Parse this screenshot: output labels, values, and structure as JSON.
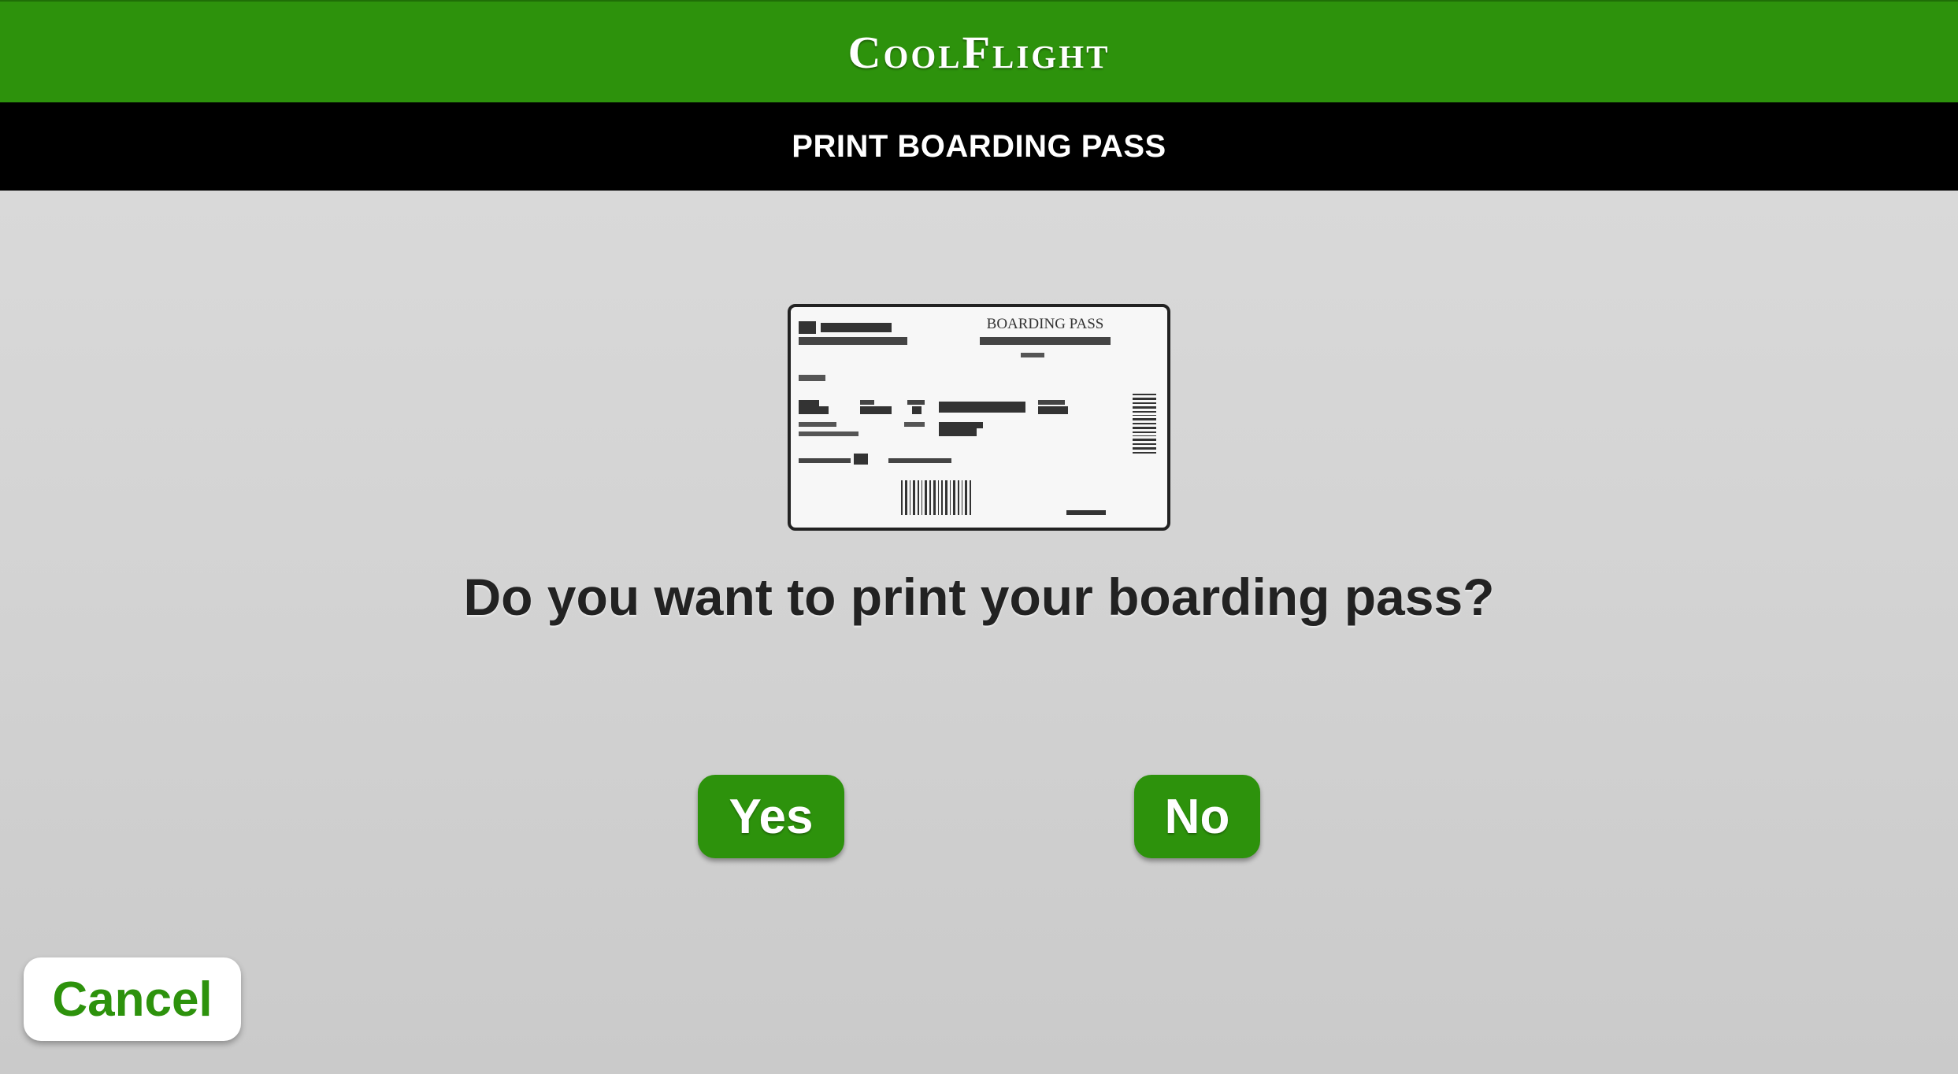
{
  "header": {
    "brand": "CoolFlight",
    "title": "PRINT BOARDING PASS"
  },
  "illustration": {
    "icon": "boarding-pass-illustration",
    "heading": "BOARDING PASS"
  },
  "prompt": {
    "question": "Do you want to print your boarding pass?"
  },
  "actions": {
    "yes_label": "Yes",
    "no_label": "No",
    "cancel_label": "Cancel"
  },
  "colors": {
    "brand_green": "#2d920c",
    "title_bar": "#000000",
    "background": "#d3d3d3"
  }
}
